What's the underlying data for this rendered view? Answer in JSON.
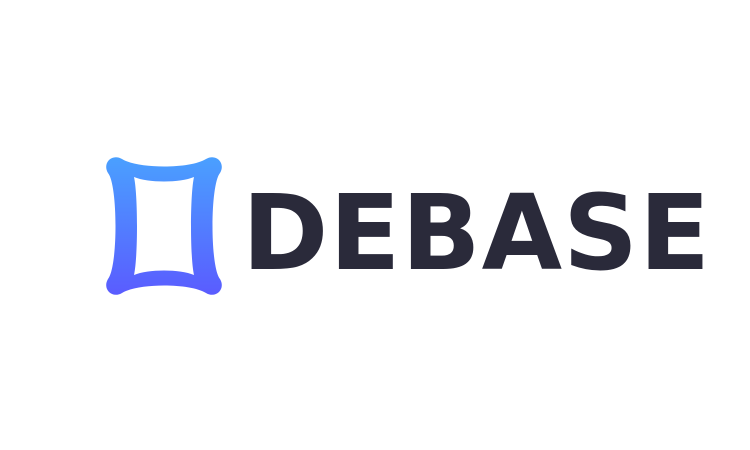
{
  "brand": {
    "name": "DEBASE",
    "icon": "rounded-frame-logo-icon",
    "colors": {
      "wordmark": "#2a2a3a",
      "gradient_top": "#4aa0ff",
      "gradient_bottom": "#5a5cff",
      "background": "#ffffff"
    }
  }
}
